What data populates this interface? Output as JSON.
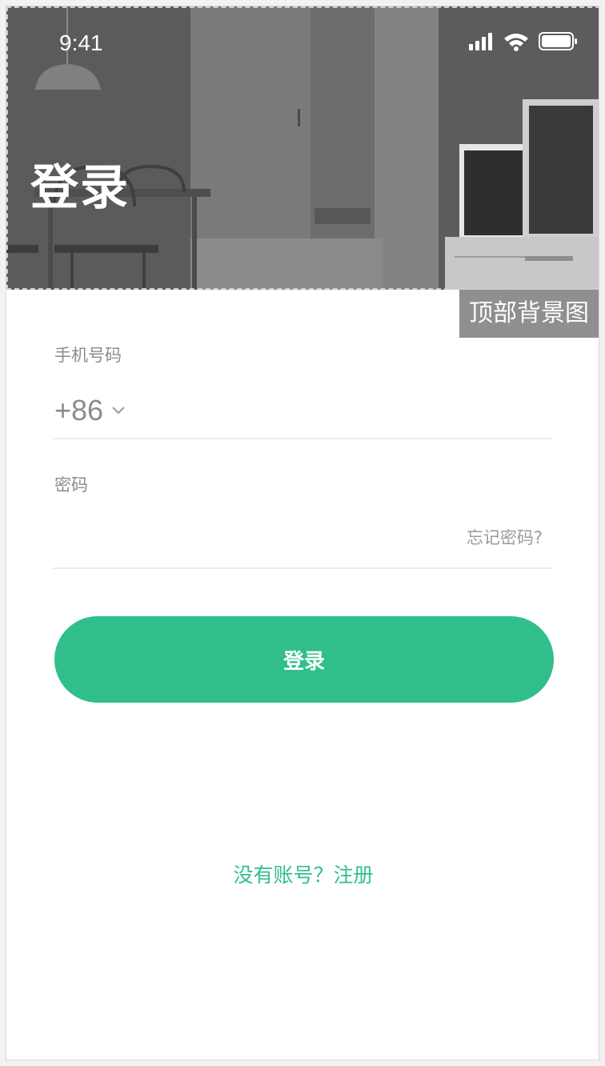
{
  "status_bar": {
    "time": "9:41"
  },
  "hero": {
    "title": "登录",
    "bg_tag": "顶部背景图"
  },
  "form": {
    "phone_label": "手机号码",
    "country_code": "+86",
    "password_label": "密码",
    "forgot_password": "忘记密码?"
  },
  "login_button": "登录",
  "register_link": "没有账号？注册",
  "colors": {
    "accent": "#30bf8a",
    "muted_text": "#8c8c8c"
  }
}
